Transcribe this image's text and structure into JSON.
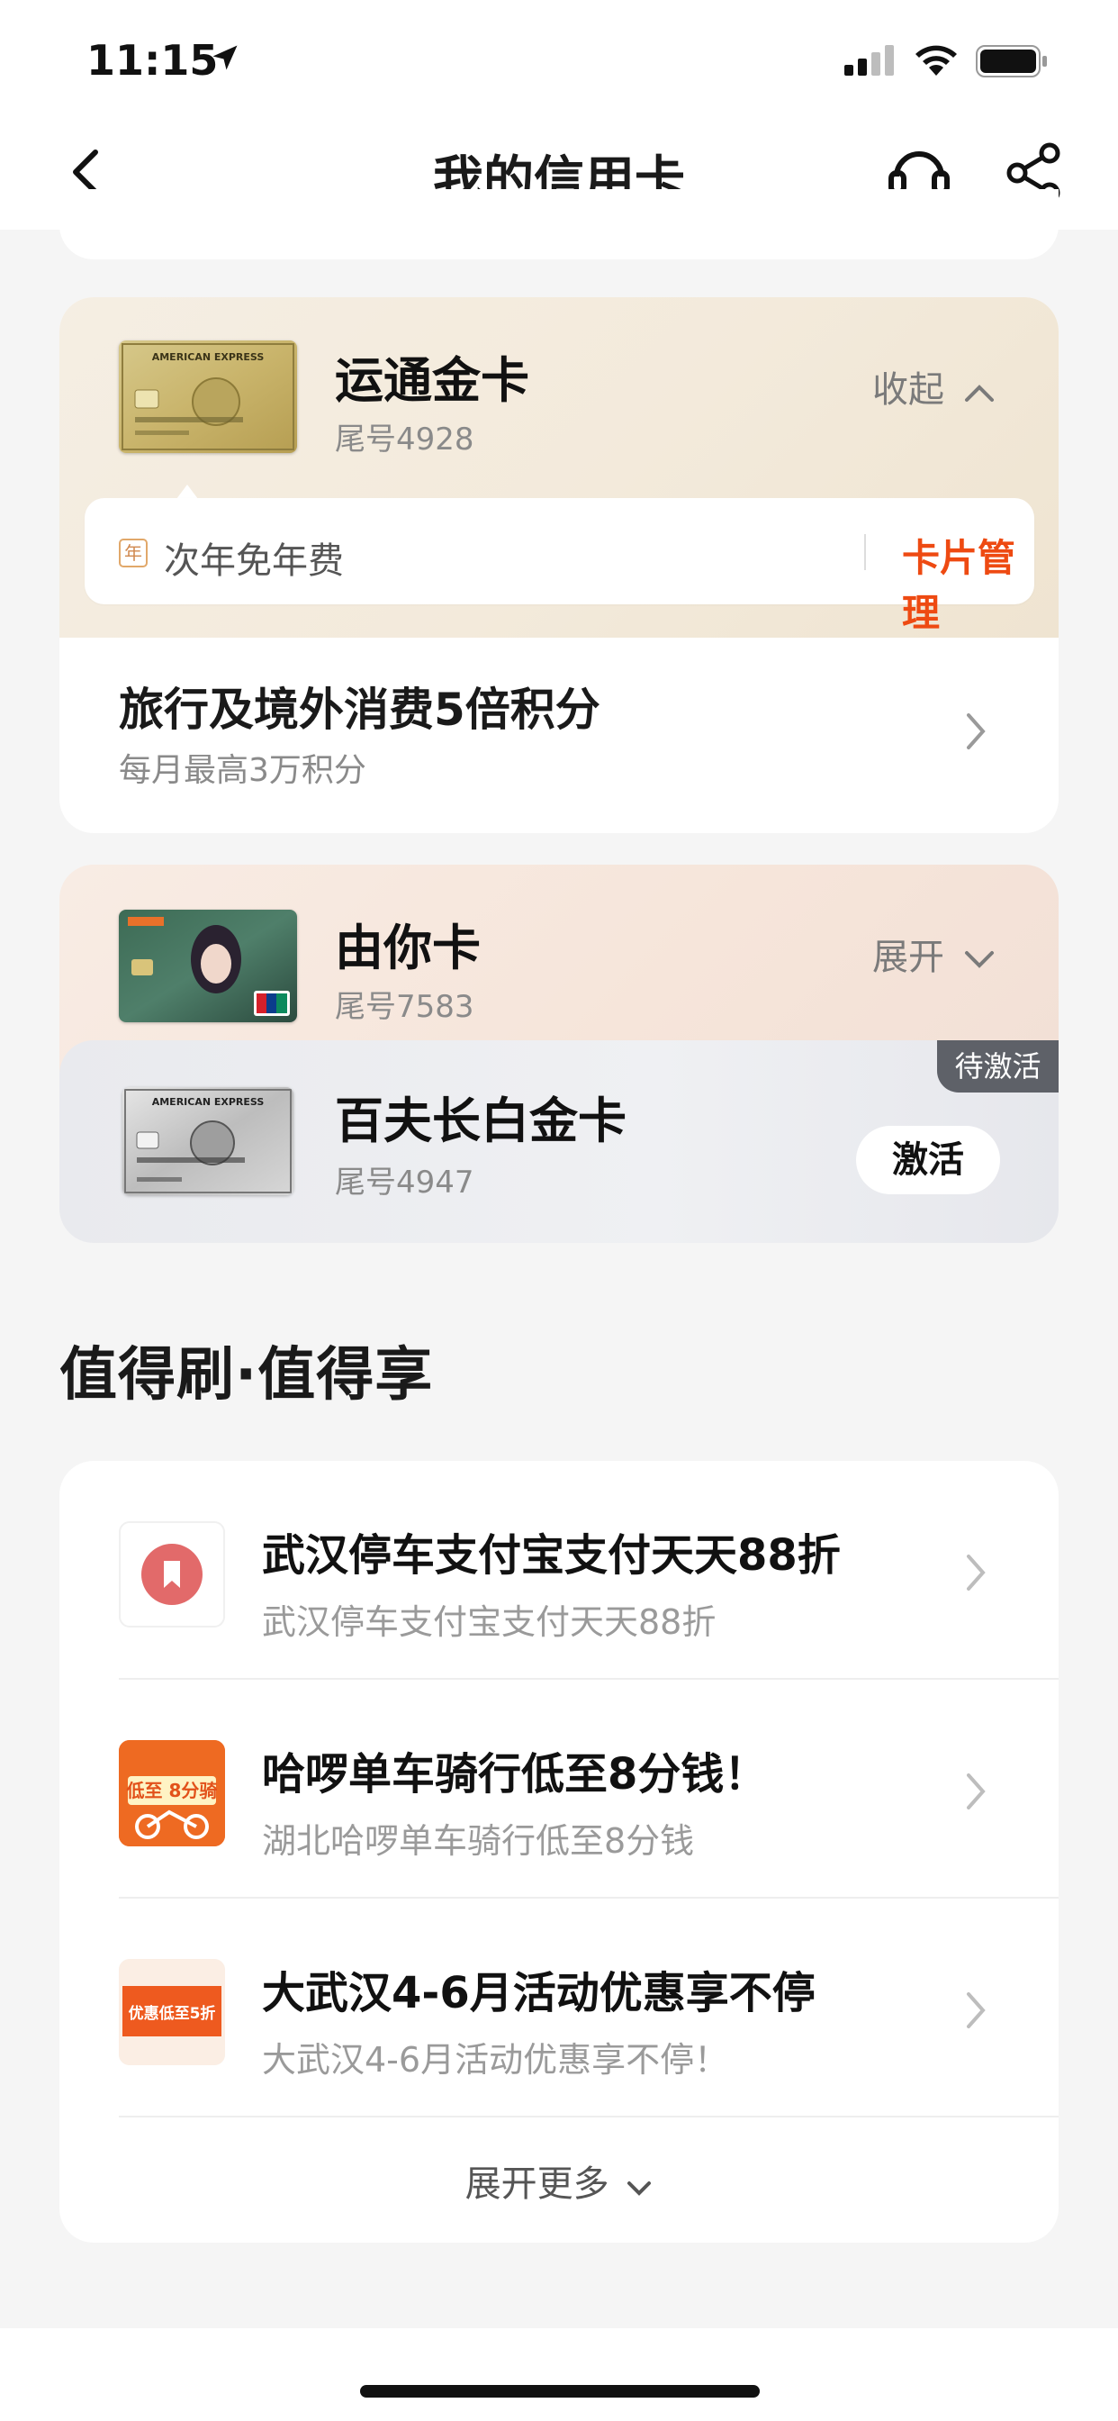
{
  "status_bar": {
    "time": "11:15"
  },
  "nav": {
    "title": "我的信用卡"
  },
  "cards": {
    "amex_gold": {
      "name": "运通金卡",
      "tail": "尾号4928",
      "toggle": "收起",
      "fee_badge": "年",
      "fee_text": "次年免年费",
      "manage": "卡片管理",
      "benefit_title": "旅行及境外消费5倍积分",
      "benefit_sub": "每月最高3万积分",
      "thumb_brand": "AMERICAN EXPRESS"
    },
    "youni": {
      "name": "由你卡",
      "tail": "尾号7583",
      "toggle": "展开"
    },
    "platinum": {
      "name": "百夫长白金卡",
      "tail": "尾号4947",
      "badge": "待激活",
      "activate": "激活",
      "thumb_brand": "AMERICAN EXPRESS"
    }
  },
  "section": {
    "title": "值得刷·值得享"
  },
  "promos": [
    {
      "title": "武汉停车支付宝支付天天88折",
      "subtitle": "武汉停车支付宝支付天天88折"
    },
    {
      "title": "哈啰单车骑行低至8分钱！",
      "subtitle": "湖北哈啰单车骑行低至8分钱",
      "thumb_text": "低至 8分骑"
    },
    {
      "title": "大武汉4-6月活动优惠享不停",
      "subtitle": "大武汉4-6月活动优惠享不停！",
      "thumb_text": "优惠低至5折"
    }
  ],
  "expand_more": "展开更多",
  "colors": {
    "accent": "#ee4a12",
    "muted": "#8a8a8a",
    "badge_bg": "#5e6168"
  }
}
